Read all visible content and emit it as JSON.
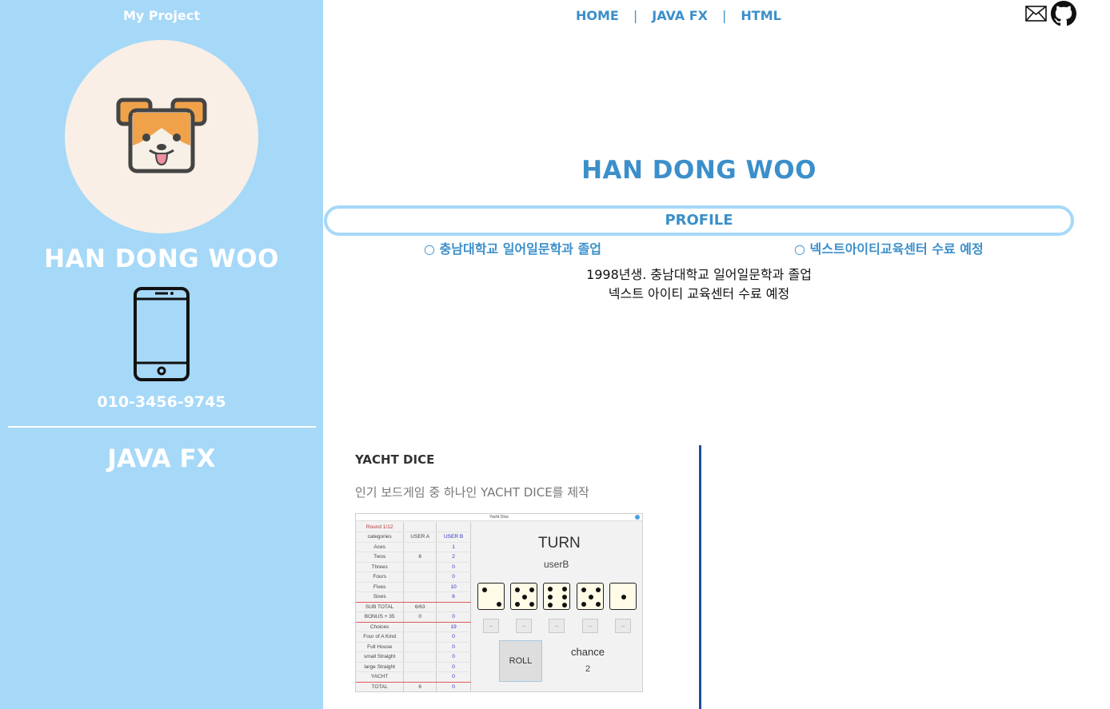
{
  "sidebar": {
    "title": "My Project",
    "name": "HAN DONG WOO",
    "phone": "010-3456-9745",
    "section": "JAVA FX",
    "avatar_icon": "dog-icon",
    "phone_icon": "smartphone-icon"
  },
  "nav": {
    "home": "HOME",
    "javafx": "JAVA FX",
    "html": "HTML",
    "separator": "|"
  },
  "header_icons": [
    "mail-icon",
    "github-icon"
  ],
  "main": {
    "name": "HAN DONG WOO",
    "profile_label": "PROFILE",
    "education": [
      "충남대학교 일어일문학과 졸업",
      "넥스트아이티교육센터 수료 예정"
    ],
    "bio_line1": "1998년생. 충남대학교 일어일문학과 졸업",
    "bio_line2": "넥스트 아이티 교육센터 수료 예정"
  },
  "project": {
    "title": "YACHT DICE",
    "description": "인기 보드게임 중 하나인 YACHT DICE를 제작",
    "screenshot": {
      "window_title": "Yacht Dice",
      "round": "Round 1/12",
      "headers": [
        "categories",
        "USER A",
        "USER B"
      ],
      "rows": [
        [
          "Aces",
          "",
          "1"
        ],
        [
          "Twos",
          "6",
          "2"
        ],
        [
          "Threes",
          "",
          "0"
        ],
        [
          "Fours",
          "",
          "0"
        ],
        [
          "Fives",
          "",
          "10"
        ],
        [
          "Sixes",
          "",
          "6"
        ],
        [
          "SUB TOTAL",
          "6/63",
          ""
        ],
        [
          "BONUS + 35",
          "0",
          "0"
        ],
        [
          "Choices",
          "",
          "19"
        ],
        [
          "Four of A Kind",
          "",
          "0"
        ],
        [
          "Full House",
          "",
          "0"
        ],
        [
          "small Straight",
          "",
          "0"
        ],
        [
          "large Straight",
          "",
          "0"
        ],
        [
          "YACHT",
          "",
          "0"
        ],
        [
          "TOTAL",
          "6",
          "0"
        ]
      ],
      "turn_label": "TURN",
      "turn_user": "userB",
      "dice": [
        2,
        5,
        6,
        5,
        1
      ],
      "hold_label": "...",
      "roll_label": "ROLL",
      "chance_label": "chance",
      "chance_value": "2"
    }
  },
  "colors": {
    "sidebar_bg": "#a6d8f8",
    "accent": "#3b8fca",
    "divider": "#1f4f9c"
  }
}
